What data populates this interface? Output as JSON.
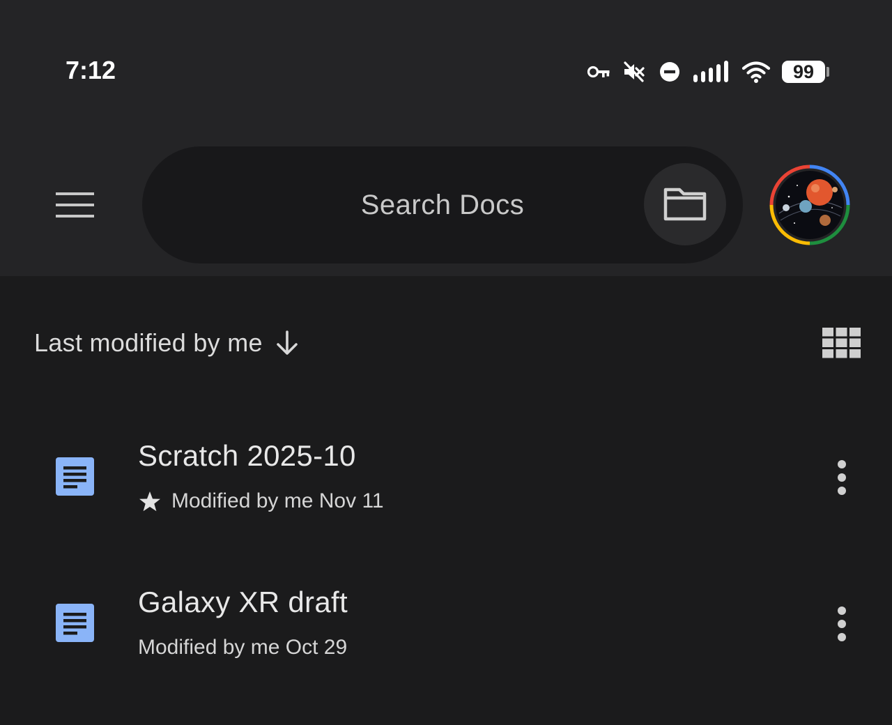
{
  "status_bar": {
    "time": "7:12",
    "battery_level": "99",
    "icons": [
      "vpn-key-icon",
      "vibrate-off-icon",
      "do-not-disturb-icon",
      "cellular-signal-icon",
      "wifi-icon",
      "battery-icon"
    ]
  },
  "app_bar": {
    "menu_icon": "hamburger-menu-icon",
    "search_placeholder": "Search Docs",
    "folder_icon": "folder-icon",
    "avatar": "account-avatar"
  },
  "sort": {
    "label": "Last modified by me",
    "direction_icon": "arrow-down-icon",
    "view_toggle_icon": "grid-view-icon"
  },
  "documents": [
    {
      "title": "Scratch 2025-10",
      "meta": "Modified by me Nov 11",
      "starred": true,
      "icon": "docs-file-icon",
      "menu_icon": "more-vertical-icon"
    },
    {
      "title": "Galaxy XR draft",
      "meta": "Modified by me Oct 29",
      "starred": false,
      "icon": "docs-file-icon",
      "menu_icon": "more-vertical-icon"
    }
  ],
  "colors": {
    "background": "#1b1b1c",
    "top_bar": "#242426",
    "search_pill": "#18181a",
    "doc_icon": "#8ab4f8",
    "text_primary": "#e8e8e8"
  }
}
